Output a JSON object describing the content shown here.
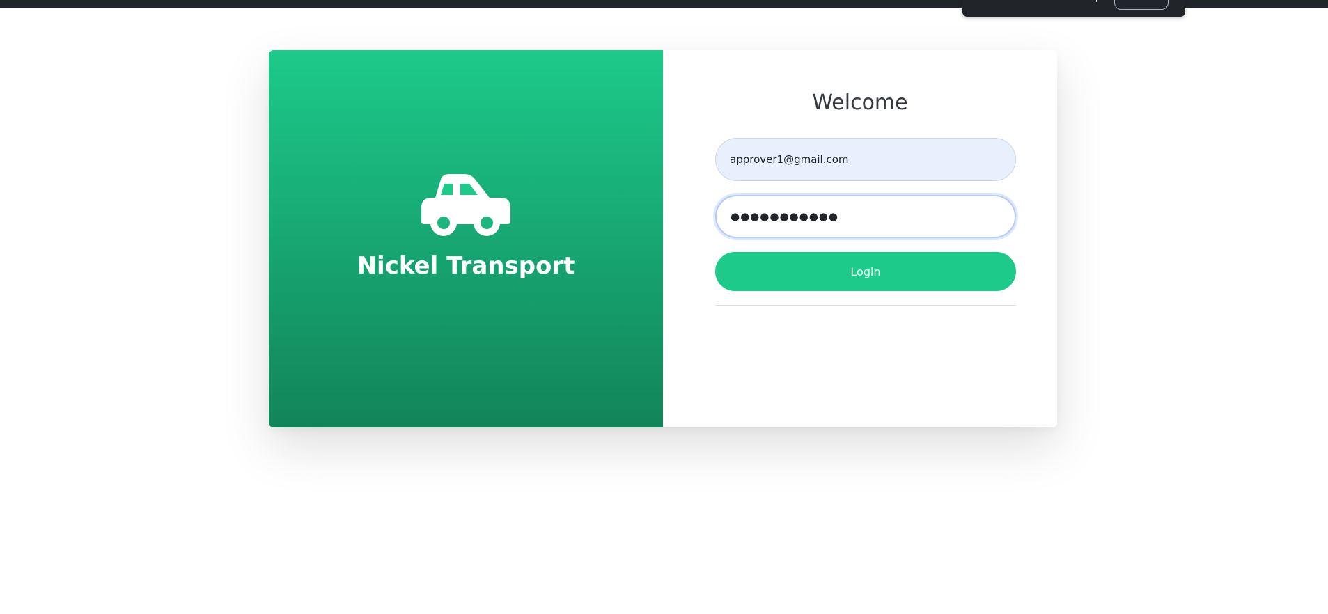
{
  "brand": {
    "name": "Nickel Transport",
    "icon": "car-icon",
    "gradient_top": "#1dca8a",
    "gradient_bottom": "#12845a"
  },
  "form": {
    "heading": "Welcome",
    "email_value": "approver1@gmail.com",
    "password_value": "●●●●●●●●●●●",
    "login_label": "Login",
    "accent_color": "#1dca8a"
  }
}
